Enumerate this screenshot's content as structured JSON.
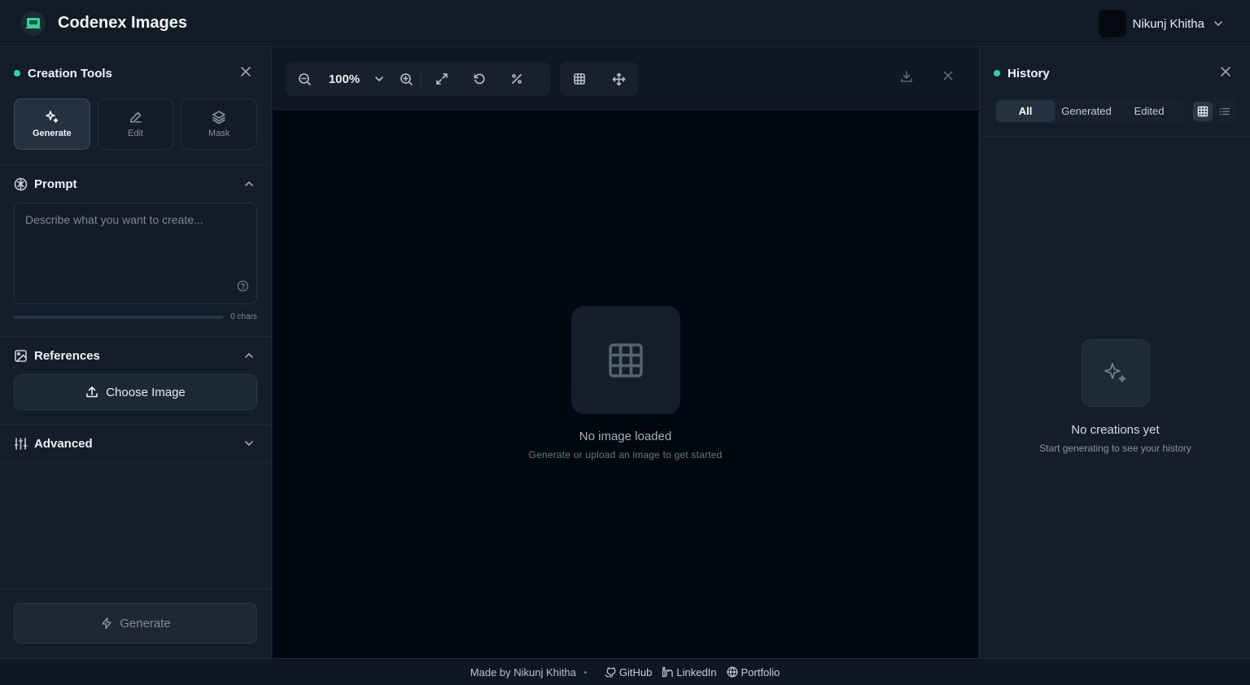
{
  "header": {
    "brand": "Codenex Images",
    "user_name": "Nikunj Khitha",
    "accent": "#34d399"
  },
  "left_panel": {
    "title": "Creation Tools",
    "modes": [
      {
        "label": "Generate",
        "icon": "sparkles-icon",
        "active": true
      },
      {
        "label": "Edit",
        "icon": "pencil-icon",
        "active": false
      },
      {
        "label": "Mask",
        "icon": "layers-icon",
        "active": false
      }
    ],
    "prompt": {
      "title": "Prompt",
      "placeholder": "Describe what you want to create...",
      "value": "",
      "char_count": "0 chars"
    },
    "references": {
      "title": "References",
      "button": "Choose Image"
    },
    "advanced": {
      "title": "Advanced"
    },
    "generate_button": "Generate"
  },
  "toolbar": {
    "zoom": "100%"
  },
  "canvas": {
    "empty_title": "No image loaded",
    "empty_subtitle": "Generate or upload an image to get started"
  },
  "history": {
    "title": "History",
    "filters": [
      "All",
      "Generated",
      "Edited"
    ],
    "active_filter": "All",
    "empty_title": "No creations yet",
    "empty_subtitle": "Start generating to see your history"
  },
  "footer": {
    "made_by": "Made by Nikunj Khitha",
    "links": [
      "GitHub",
      "LinkedIn",
      "Portfolio"
    ]
  }
}
